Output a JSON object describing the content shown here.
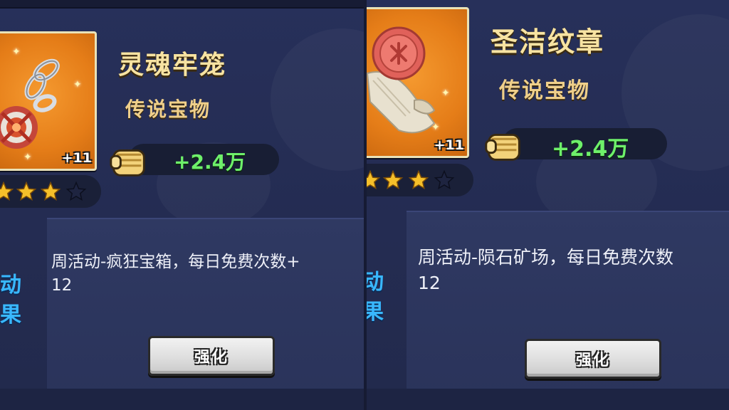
{
  "panels": [
    {
      "item_name": "灵魂牢笼",
      "rarity": "传说宝物",
      "level": "+11",
      "stars": 4,
      "stars_max": 5,
      "power": "+2.4万",
      "description_line1": "周活动-疯狂宝箱，每日免费次数+",
      "description_line2": "12",
      "side_label_1": "动",
      "side_label_2": "果",
      "button_label": "强化",
      "item_icon": "chain-cage-icon"
    },
    {
      "item_name": "圣洁纹章",
      "rarity": "传说宝物",
      "level": "+11",
      "stars": 4,
      "stars_max": 5,
      "power": "+2.4万",
      "description_line1": "周活动-陨石矿场，每日免费次数",
      "description_line2": "12",
      "side_label_1": "动",
      "side_label_2": "果",
      "button_label": "强化",
      "item_icon": "wax-seal-scroll-icon"
    }
  ],
  "colors": {
    "title": "#f7e3a2",
    "power": "#6ef06a",
    "frame": "#e57d18",
    "side_label": "#39b8ff",
    "star_filled": "#f6c02a"
  }
}
